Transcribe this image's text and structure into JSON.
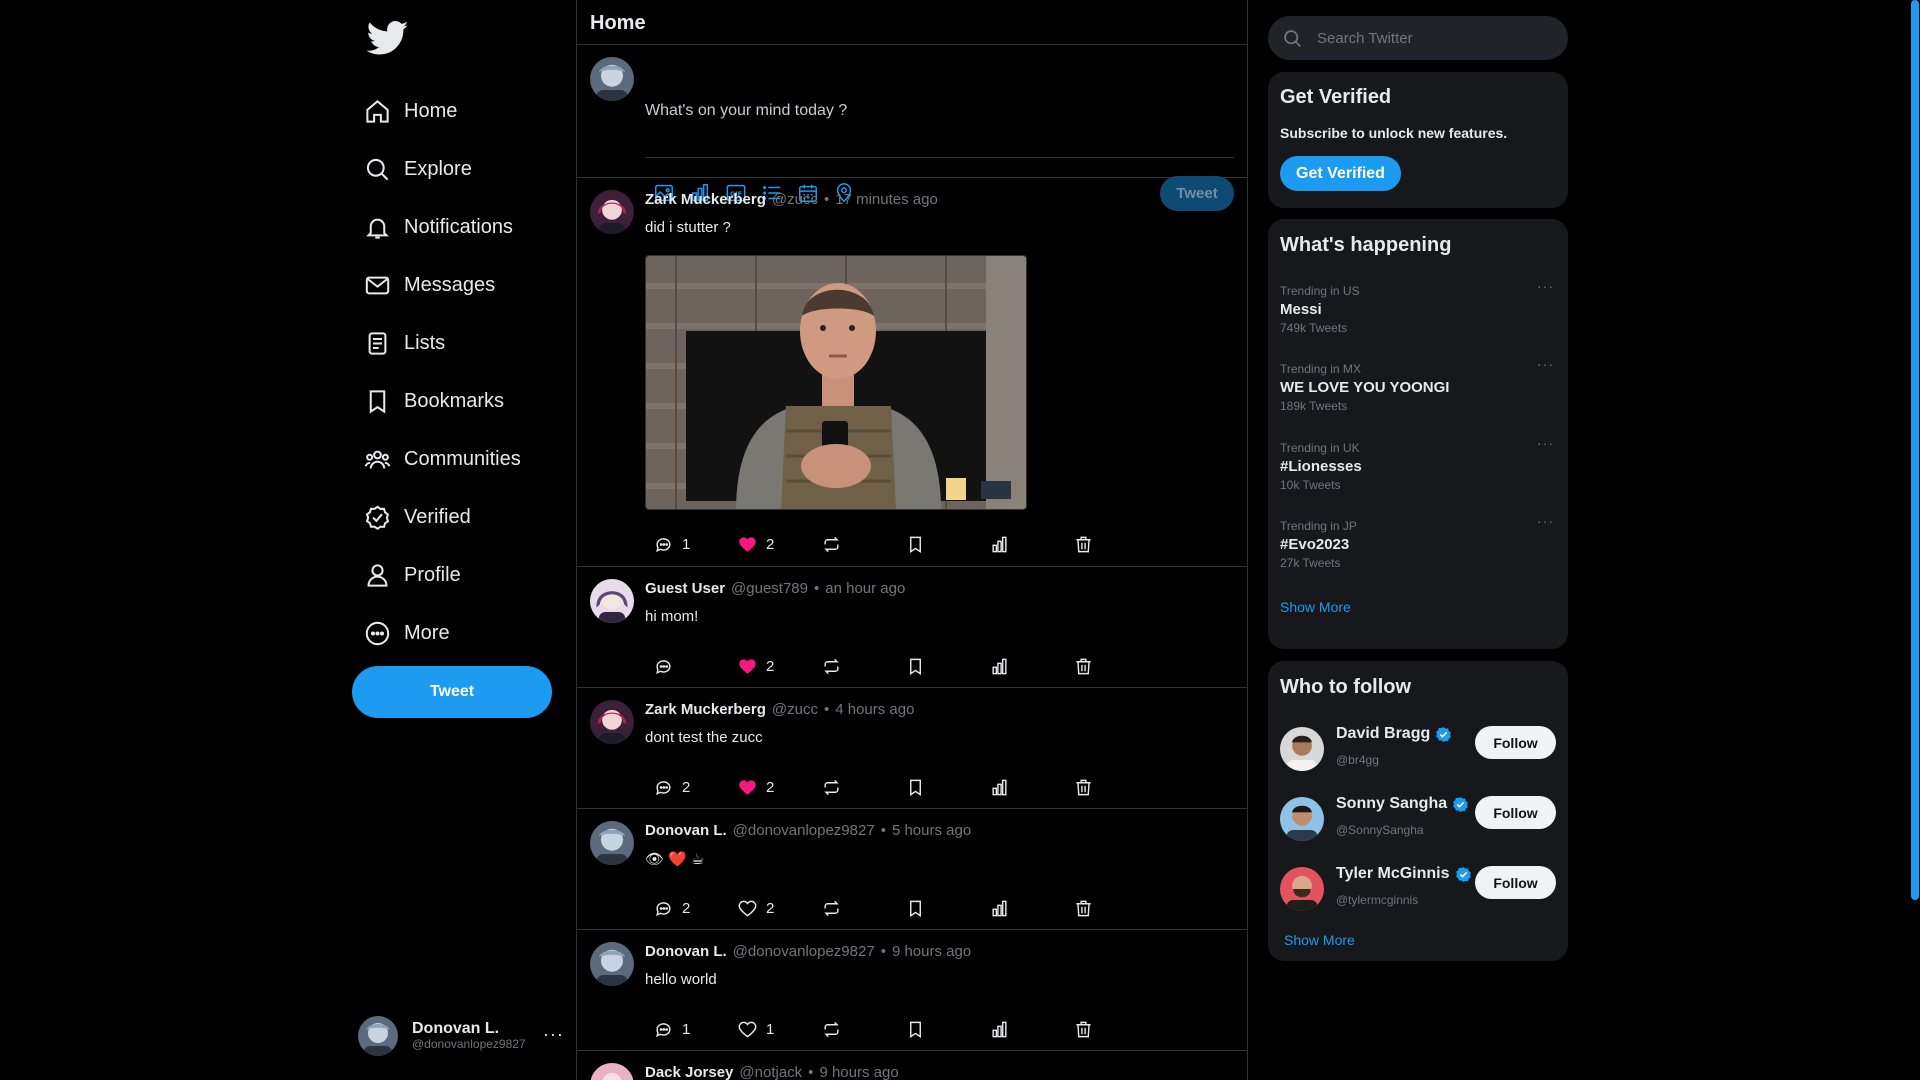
{
  "nav": {
    "items": [
      {
        "label": "Home",
        "icon": "home-icon"
      },
      {
        "label": "Explore",
        "icon": "search-icon"
      },
      {
        "label": "Notifications",
        "icon": "bell-icon"
      },
      {
        "label": "Messages",
        "icon": "mail-icon"
      },
      {
        "label": "Lists",
        "icon": "list-icon"
      },
      {
        "label": "Bookmarks",
        "icon": "bookmark-icon"
      },
      {
        "label": "Communities",
        "icon": "people-icon"
      },
      {
        "label": "Verified",
        "icon": "verified-icon"
      },
      {
        "label": "Profile",
        "icon": "person-icon"
      },
      {
        "label": "More",
        "icon": "more-circle-icon"
      }
    ],
    "tweet_button": "Tweet"
  },
  "account": {
    "name": "Donovan L.",
    "handle": "@donovanlopez9827"
  },
  "main": {
    "title": "Home",
    "composer": {
      "placeholder": "What's on your mind today ?",
      "tweet_button": "Tweet"
    },
    "tweets": [
      {
        "name": "Zark Muckerberg",
        "handle": "@zucc",
        "time": "17 minutes ago",
        "text": "did i stutter ?",
        "replies": "1",
        "likes": "2",
        "liked": true,
        "has_image": true
      },
      {
        "name": "Guest User",
        "handle": "@guest789",
        "time": "an hour ago",
        "text": "hi mom!",
        "replies": "",
        "likes": "2",
        "liked": true
      },
      {
        "name": "Zark Muckerberg",
        "handle": "@zucc",
        "time": "4 hours ago",
        "text": "dont test the zucc",
        "replies": "2",
        "likes": "2",
        "liked": true
      },
      {
        "name": "Donovan L.",
        "handle": "@donovanlopez9827",
        "time": "5 hours ago",
        "text": "👁 ❤️ ☕",
        "replies": "2",
        "likes": "2",
        "liked": false
      },
      {
        "name": "Donovan L.",
        "handle": "@donovanlopez9827",
        "time": "9 hours ago",
        "text": "hello world",
        "replies": "1",
        "likes": "1",
        "liked": false
      },
      {
        "name": "Dack Jorsey",
        "handle": "@notjack",
        "time": "9 hours ago",
        "text": "",
        "replies": "",
        "likes": "",
        "liked": false
      }
    ]
  },
  "search": {
    "placeholder": "Search Twitter"
  },
  "verified": {
    "title": "Get Verified",
    "subtitle": "Subscribe to unlock new features.",
    "button": "Get Verified"
  },
  "trends": {
    "title": "What's happening",
    "items": [
      {
        "meta": "Trending in US",
        "topic": "Messi",
        "count": "749k Tweets"
      },
      {
        "meta": "Trending in MX",
        "topic": "WE LOVE YOU YOONGI",
        "count": "189k Tweets"
      },
      {
        "meta": "Trending in UK",
        "topic": "#Lionesses",
        "count": "10k Tweets"
      },
      {
        "meta": "Trending in JP",
        "topic": "#Evo2023",
        "count": "27k Tweets"
      }
    ],
    "show_more": "Show More"
  },
  "who_to_follow": {
    "title": "Who to follow",
    "items": [
      {
        "name": "David Bragg",
        "handle": "@br4gg",
        "button": "Follow"
      },
      {
        "name": "Sonny Sangha",
        "handle": "@SonnySangha",
        "button": "Follow"
      },
      {
        "name": "Tyler McGinnis",
        "handle": "@tylermcginnis",
        "button": "Follow"
      }
    ],
    "show_more": "Show More"
  },
  "colors": {
    "accent": "#1d9bf0",
    "like": "#f91880",
    "background": "#000000",
    "card": "#16181c",
    "border": "#2f3336"
  }
}
